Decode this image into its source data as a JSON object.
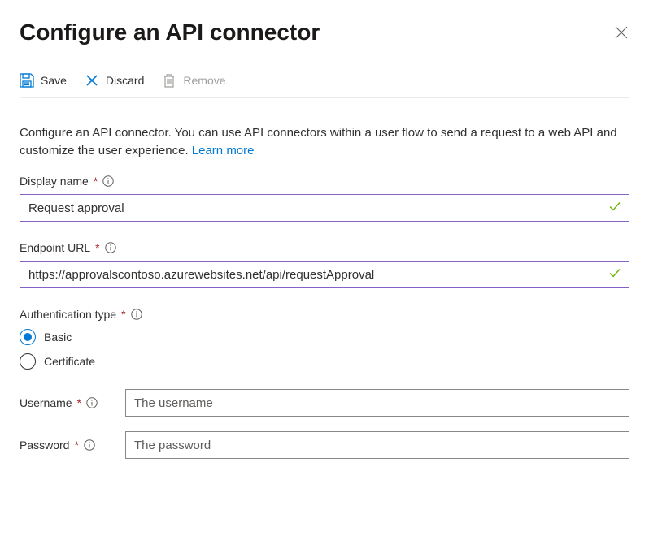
{
  "header": {
    "title": "Configure an API connector"
  },
  "toolbar": {
    "save_label": "Save",
    "discard_label": "Discard",
    "remove_label": "Remove"
  },
  "description": {
    "text": "Configure an API connector. You can use API connectors within a user flow to send a request to a web API and customize the user experience. ",
    "link_text": "Learn more"
  },
  "fields": {
    "display_name": {
      "label": "Display name",
      "value": "Request approval"
    },
    "endpoint_url": {
      "label": "Endpoint URL",
      "value": "https://approvalscontoso.azurewebsites.net/api/requestApproval"
    },
    "auth_type": {
      "label": "Authentication type",
      "options": {
        "basic": "Basic",
        "certificate": "Certificate"
      },
      "selected": "basic"
    },
    "username": {
      "label": "Username",
      "placeholder": "The username"
    },
    "password": {
      "label": "Password",
      "placeholder": "The password"
    }
  }
}
